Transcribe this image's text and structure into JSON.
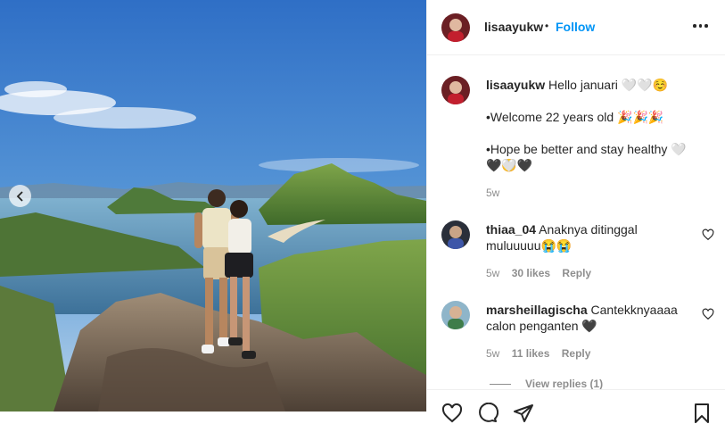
{
  "post": {
    "username": "lisaayukw",
    "separator": "•",
    "follow_label": "Follow"
  },
  "caption": {
    "username": "lisaayukw",
    "line1": "Hello januari 🤍🤍☺️",
    "line2": "•Welcome 22 years old 🎉🎉🎉",
    "line3": "•Hope be better and stay healthy 🤍🤍🥹",
    "line4": "🖤🤍🖤",
    "time": "5w"
  },
  "comments": [
    {
      "username": "thiaa_04",
      "text": "Anaknya ditinggal muluuuuu😭😭",
      "time": "5w",
      "likes": "30 likes",
      "reply": "Reply"
    },
    {
      "username": "marsheillagischa",
      "text": "Cantekknyaaaa calon penganten 🖤",
      "time": "5w",
      "likes": "11 likes",
      "reply": "Reply"
    }
  ],
  "view_replies": "View replies (1)",
  "icons": {
    "prev": "chevron-left-icon",
    "more": "more-options-icon",
    "like": "heart-icon",
    "comment": "comment-icon",
    "share": "share-icon",
    "save": "bookmark-icon"
  },
  "colors": {
    "link_blue": "#0095f6",
    "text": "#262626",
    "muted": "#8e8e8e",
    "border": "#efefef"
  }
}
